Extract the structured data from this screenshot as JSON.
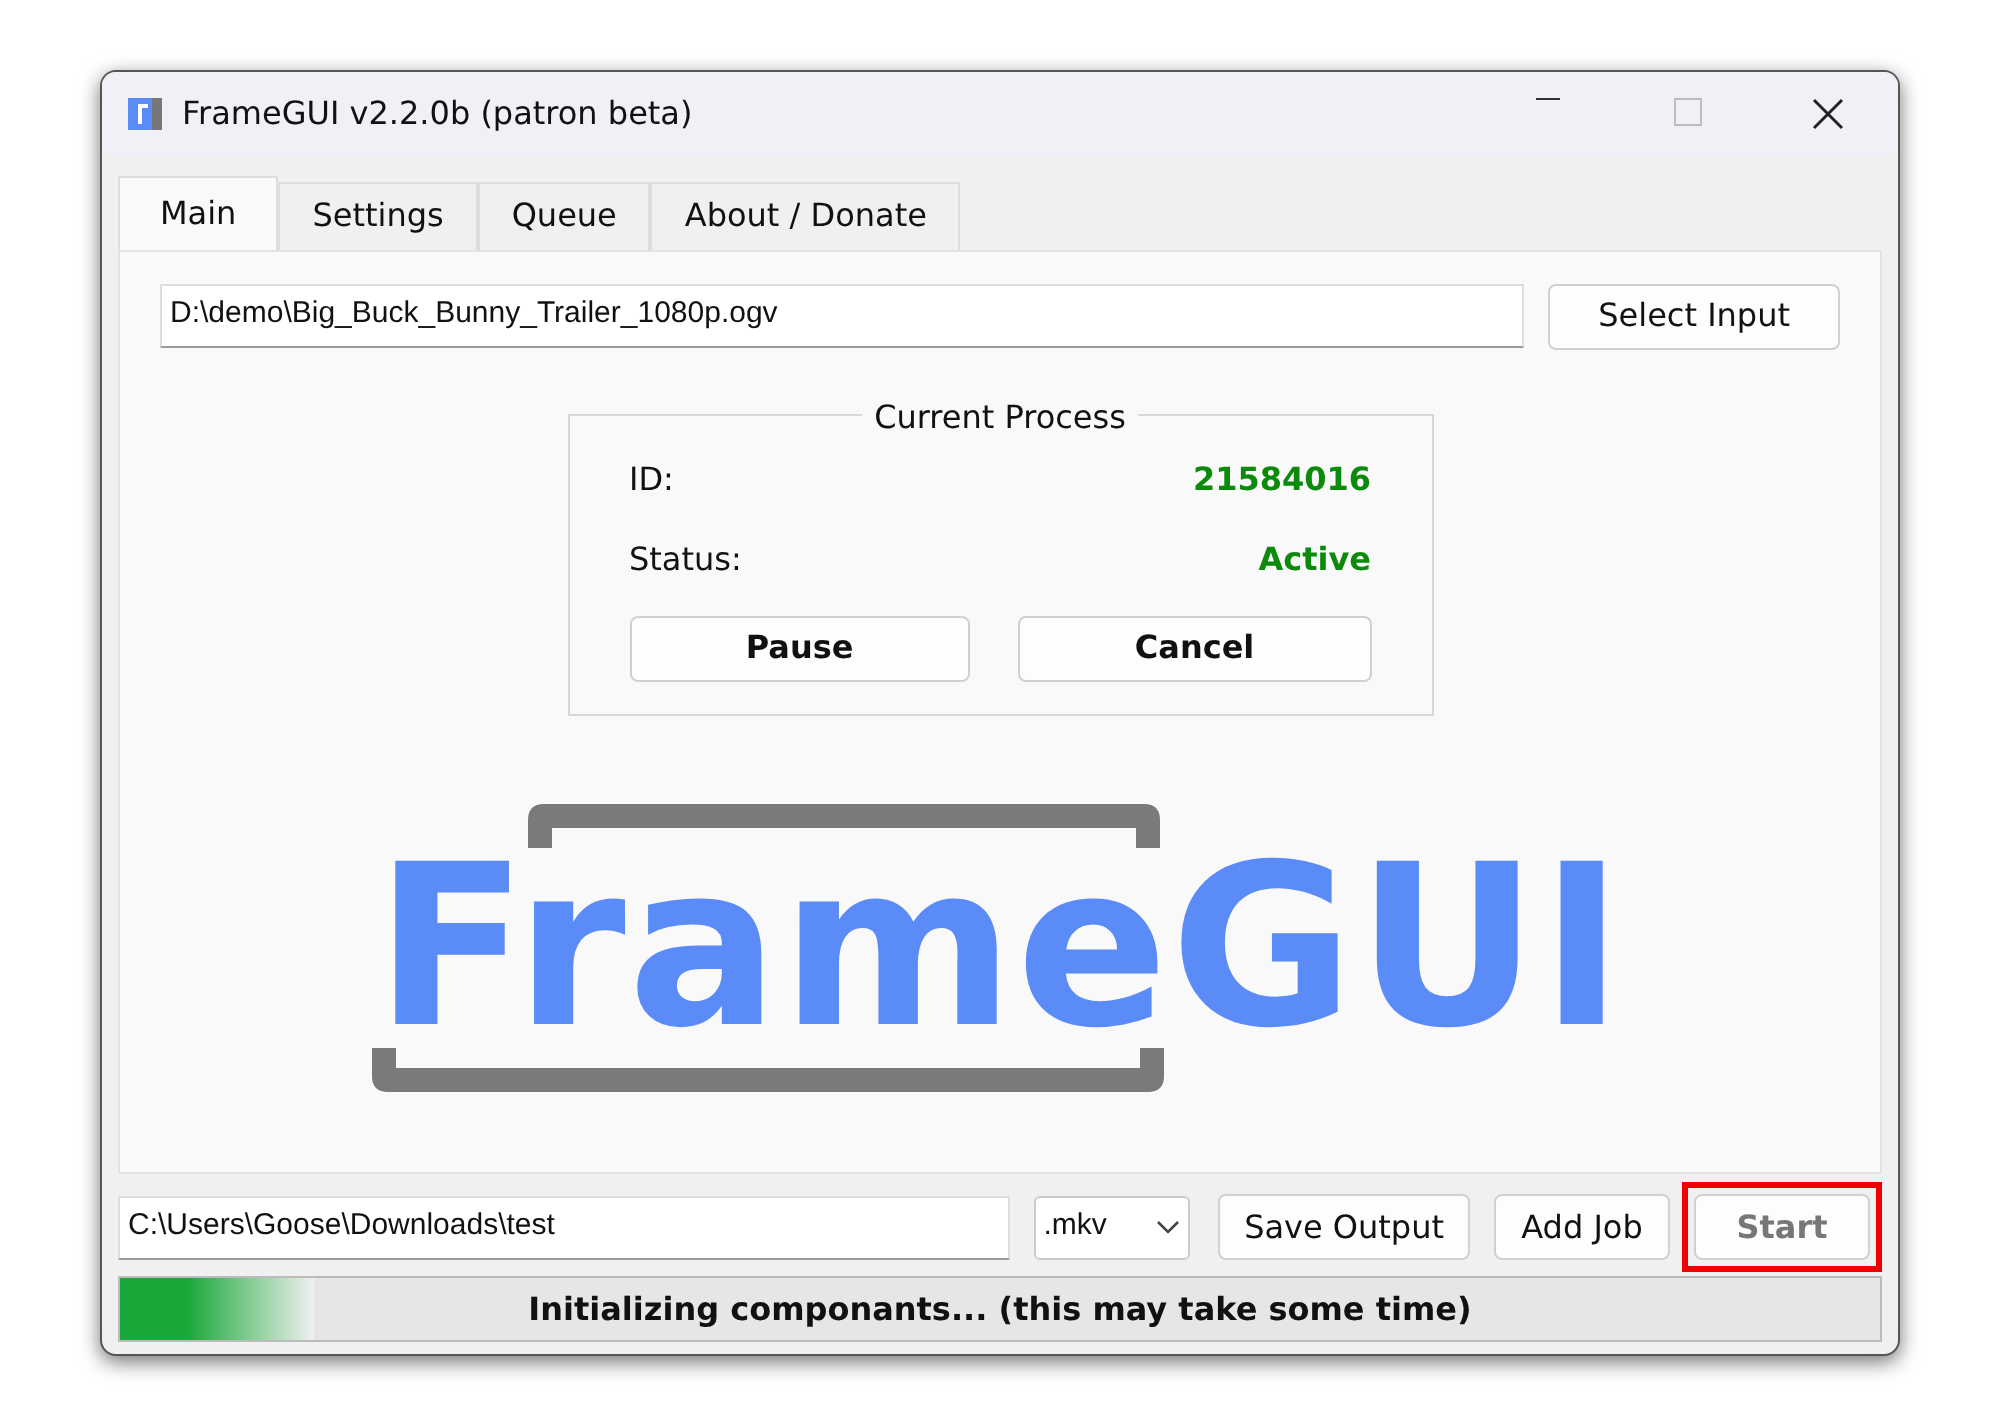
{
  "window": {
    "title": "FrameGUI v2.2.0b (patron beta)"
  },
  "tabs": [
    {
      "label": "Main",
      "selected": true
    },
    {
      "label": "Settings",
      "selected": false
    },
    {
      "label": "Queue",
      "selected": false
    },
    {
      "label": "About / Donate",
      "selected": false
    }
  ],
  "input": {
    "value": "D:\\demo\\Big_Buck_Bunny_Trailer_1080p.ogv",
    "button": "Select Input"
  },
  "process": {
    "title": "Current Process",
    "rows": [
      {
        "label": "ID:",
        "value": "21584016"
      },
      {
        "label": "Status:",
        "value": "Active"
      }
    ],
    "buttons": [
      "Pause",
      "Cancel"
    ]
  },
  "logo": "FrameGUI",
  "output": {
    "value": "C:\\Users\\Goose\\Downloads\\test",
    "format": ".mkv"
  },
  "actions": [
    {
      "label": "Save Output",
      "disabled": false,
      "highlighted": false
    },
    {
      "label": "Add Job",
      "disabled": false,
      "highlighted": false
    },
    {
      "label": "Start",
      "disabled": true,
      "highlighted": true
    }
  ],
  "progress": {
    "level": 0.11,
    "text": "Initializing componants... (this may take some time)"
  }
}
